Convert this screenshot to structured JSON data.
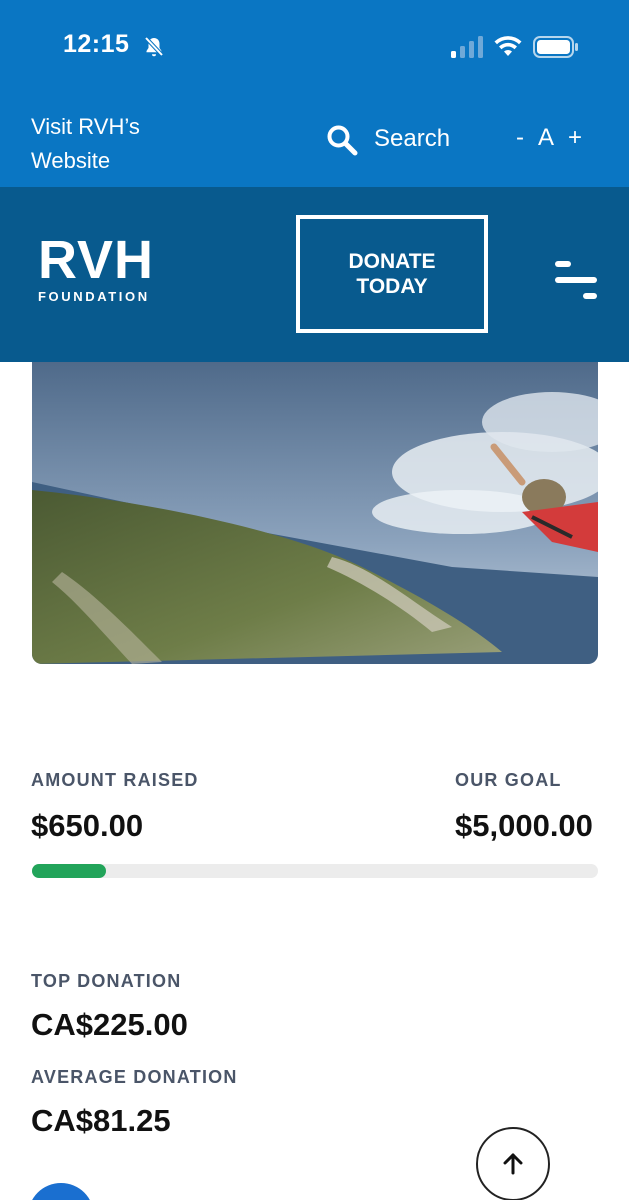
{
  "status_bar": {
    "time": "12:15",
    "icons": [
      "bell-slash-icon",
      "signal-icon",
      "wifi-icon",
      "battery-icon"
    ]
  },
  "utility_bar": {
    "visit_link": "Visit RVH’s Website",
    "search_label": "Search",
    "decrease_text": "-",
    "text_size_letter": "A",
    "increase_text": "+"
  },
  "header": {
    "logo_main": "RVH",
    "logo_sub": "FOUNDATION",
    "donate_label_line1": "DONATE",
    "donate_label_line2": "TODAY"
  },
  "stats": {
    "amount_raised_label": "AMOUNT RAISED",
    "amount_raised_value": "$650.00",
    "goal_label": "OUR GOAL",
    "goal_value": "$5,000.00",
    "progress_fraction": 0.13,
    "top_donation_label": "TOP DONATION",
    "top_donation_value": "CA$225.00",
    "average_donation_label": "AVERAGE DONATION",
    "average_donation_value": "CA$81.25"
  },
  "colors": {
    "topbar": "#0a76c3",
    "header": "#085a8e",
    "progress": "#22a45a",
    "avatar": "#1a6fd0"
  }
}
